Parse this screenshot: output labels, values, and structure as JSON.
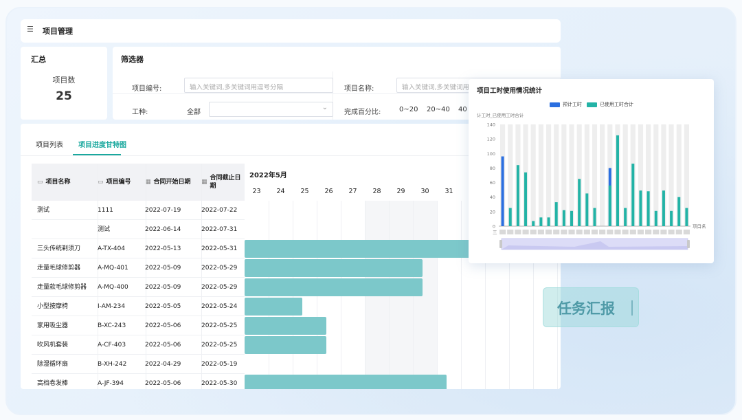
{
  "topbar": {
    "menu_icon": "menu-fold-icon",
    "title": "项目管理"
  },
  "summary": {
    "title": "汇总",
    "label": "项目数",
    "value": "25"
  },
  "filter": {
    "title": "筛选器",
    "project_code_label": "项目编号:",
    "project_code_placeholder": "输入关键词,多关键词用逗号分隔",
    "project_name_label": "项目名称:",
    "project_name_placeholder": "输入关键词,多关键词用逗号分隔",
    "work_type_label": "工种:",
    "work_type_value": "全部",
    "percent_label": "完成百分比:",
    "percent_options": [
      "0~20",
      "20~40",
      "40"
    ]
  },
  "tabs": [
    {
      "label": "项目列表",
      "active": false
    },
    {
      "label": "项目进度甘特图",
      "active": true
    }
  ],
  "table": {
    "headers": [
      "项目名称",
      "项目编号",
      "合同开始日期",
      "合同截止日期"
    ],
    "rows": [
      {
        "name": "测试",
        "code": "1111",
        "start": "2022-07-19",
        "end": "2022-07-22"
      },
      {
        "name": "",
        "code": "测试",
        "start": "2022-06-14",
        "end": "2022-07-31"
      },
      {
        "name": "三头传统剃须刀",
        "code": "A-TX-404",
        "start": "2022-05-13",
        "end": "2022-05-31"
      },
      {
        "name": "走量毛球修剪器",
        "code": "A-MQ-401",
        "start": "2022-05-09",
        "end": "2022-05-29"
      },
      {
        "name": "走量款毛球修剪器",
        "code": "A-MQ-400",
        "start": "2022-05-09",
        "end": "2022-05-29"
      },
      {
        "name": "小型按摩椅",
        "code": "I-AM-234",
        "start": "2022-05-05",
        "end": "2022-05-24"
      },
      {
        "name": "家用吸尘器",
        "code": "B-XC-243",
        "start": "2022-05-06",
        "end": "2022-05-25"
      },
      {
        "name": "吹风机套装",
        "code": "A-CF-403",
        "start": "2022-05-06",
        "end": "2022-05-25"
      },
      {
        "name": "除湿循环扇",
        "code": "B-XH-242",
        "start": "2022-04-29",
        "end": "2022-05-19"
      },
      {
        "name": "高档卷发棒",
        "code": "A-JF-394",
        "start": "2022-05-06",
        "end": "2022-05-30"
      }
    ]
  },
  "gantt": {
    "month": "2022年5月",
    "days": [
      "23",
      "24",
      "25",
      "26",
      "27",
      "28",
      "29",
      "30",
      "31"
    ],
    "bar_color": "#7cc8ca"
  },
  "chart_data": {
    "type": "bar",
    "title": "项目工时使用情况统计",
    "ylabel": "计工时_已使用工时合计",
    "xlabel": "项目名",
    "ylim": [
      0,
      140
    ],
    "yticks": [
      0,
      20,
      40,
      60,
      80,
      100,
      120,
      140
    ],
    "grid": false,
    "legend_position": "top",
    "x_tick_label_first": "三",
    "series": [
      {
        "name": "预计工时",
        "color": "#2b6fe0",
        "values": [
          96,
          null,
          null,
          null,
          null,
          null,
          null,
          null,
          null,
          null,
          null,
          null,
          null,
          null,
          80,
          null,
          null,
          null,
          null,
          null,
          null,
          null,
          null,
          null,
          null
        ]
      },
      {
        "name": "已使用工时合计",
        "color": "#23b3a6",
        "values": [
          null,
          25,
          84,
          74,
          7,
          12,
          12,
          33,
          22,
          21,
          65,
          45,
          25,
          null,
          56,
          125,
          25,
          86,
          49,
          48,
          21,
          49,
          21,
          40,
          25
        ]
      }
    ]
  },
  "report": {
    "label": "任务汇报"
  }
}
